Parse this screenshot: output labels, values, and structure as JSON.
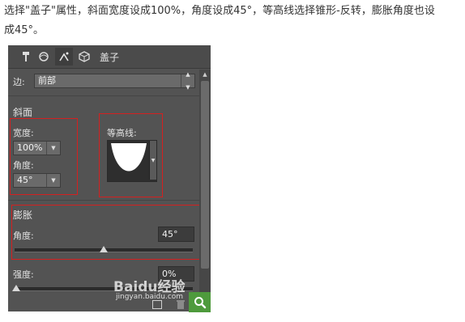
{
  "caption": {
    "line1": "选择\"盖子\"属性，斜面宽度设成100%，角度设成45°，等高线选择锥形-反转，膨胀角度也设",
    "line2": "成45°。"
  },
  "toolbar": {
    "icons": [
      "pin-icon",
      "globe-icon",
      "edit-shape-icon",
      "cube-icon"
    ],
    "label": "盖子"
  },
  "side": {
    "label": "边:",
    "value": "前部"
  },
  "bevel": {
    "title": "斜面",
    "width_label": "宽度:",
    "width_value": "100%",
    "angle_label": "角度:",
    "angle_value": "45°",
    "contour_label": "等高线:"
  },
  "inflate": {
    "title": "膨胀",
    "angle_label": "角度:",
    "angle_value": "45°",
    "angle_fraction": 0.5,
    "strength_label": "强度:",
    "strength_value": "0%",
    "strength_fraction": 0.0
  },
  "watermark": {
    "main": "Baidu经验",
    "sub": "jingyan.baidu.com"
  },
  "colors": {
    "panel": "#535353",
    "highlight": "#d42020",
    "search": "#4e9a3c"
  }
}
